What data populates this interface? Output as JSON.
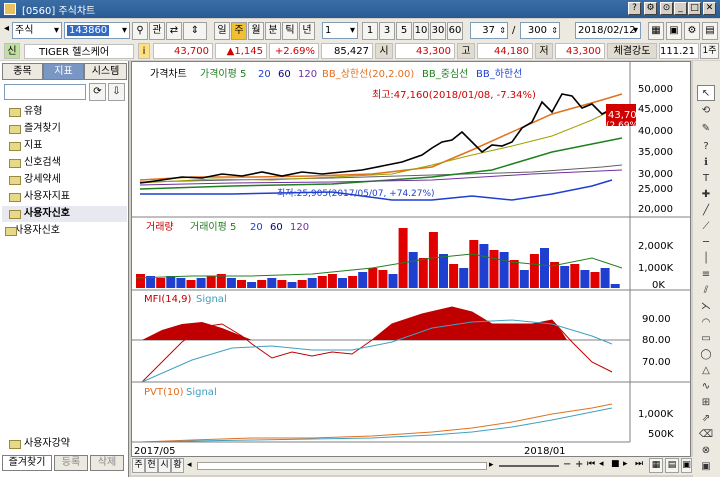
{
  "title": "[0560] 주식차트",
  "toolbar": {
    "market": "주식",
    "code": "143860",
    "btn_gwan": "관",
    "periods": [
      "일",
      "주",
      "월",
      "분",
      "틱",
      "년"
    ],
    "interval": "1",
    "steps": [
      "1",
      "3",
      "5",
      "10",
      "30",
      "60"
    ],
    "count": "37",
    "total": "300",
    "date": "2018/02/12"
  },
  "info": {
    "stock_name": "TIGER 헬스케어",
    "price": "43,700",
    "change": "▲1,145",
    "change_pct": "+2.69%",
    "volume": "85,427",
    "open_label": "시",
    "open": "43,300",
    "high_label": "고",
    "high": "44,180",
    "low_label": "저",
    "low": "43,300",
    "strength_label": "체결강도",
    "strength": "111.21",
    "unit_btn": "1주"
  },
  "sidebar": {
    "tabs": [
      "종목",
      "지표",
      "시스템"
    ],
    "folders": [
      "유형",
      "즐겨찾기",
      "지표",
      "신호검색",
      "강세약세",
      "사용자지표",
      "사용자신호"
    ],
    "subitem": "사용자신호",
    "bottom_folder": "사용자강약",
    "bottom_tabs": [
      "즐겨찾기",
      "등록",
      "삭제"
    ]
  },
  "chart": {
    "price_legend": [
      "가격차트",
      "가격이평 5",
      "20",
      "60",
      "120",
      "BB_상한선(20,2.00)",
      "BB_중심선",
      "BB_하한선"
    ],
    "max_label": "최고:47,160(2018/01/08, -7.34%)",
    "min_label": "최저:25,905(2017/05/07, +74.27%)",
    "price_axis": [
      "50,000",
      "45,000",
      "40,000",
      "35,000",
      "30,000",
      "25,000",
      "20,000"
    ],
    "current_price": "43,700",
    "current_pct": "(2.69%)",
    "vol_legend": [
      "거래량",
      "거래이평 5",
      "20",
      "60",
      "120"
    ],
    "vol_axis": [
      "2,000K",
      "1,000K",
      "0K"
    ],
    "mfi_legend": [
      "MFI(14,9)",
      "Signal"
    ],
    "mfi_axis": [
      "90.00",
      "80.00",
      "70.00"
    ],
    "pvt_legend": [
      "PVT(10)",
      "Signal"
    ],
    "pvt_axis": [
      "1,000K",
      "500K"
    ],
    "x_labels": [
      "2017/05",
      "2018/01"
    ]
  },
  "bottom": {
    "labels": [
      "주",
      "현",
      "시",
      "황"
    ]
  },
  "colors": {
    "red": "#d00000",
    "blue": "#1f3fd0",
    "title_bg": "#2a5a95"
  }
}
